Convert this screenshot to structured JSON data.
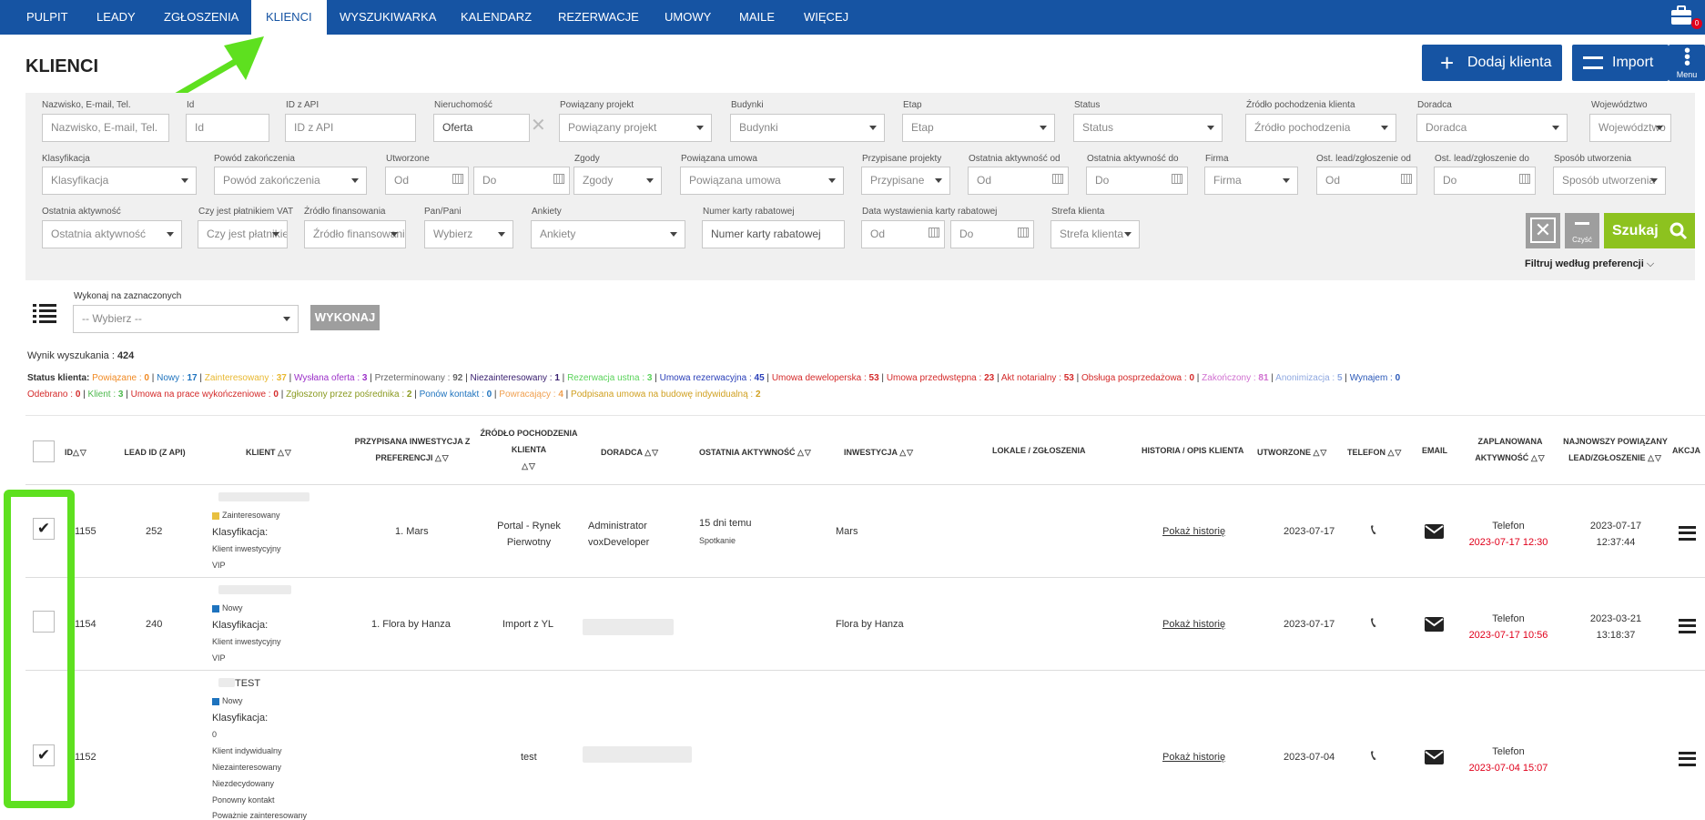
{
  "nav": {
    "items": [
      "PULPIT",
      "LEADY",
      "ZGŁOSZENIA",
      "KLIENCI",
      "WYSZUKIWARKA",
      "KALENDARZ",
      "REZERWACJE",
      "UMOWY",
      "MAILE",
      "WIĘCEJ"
    ],
    "active": "KLIENCI",
    "notif_count": "0"
  },
  "page": {
    "title": "KLIENCI",
    "add_label": "Dodaj klienta",
    "import_label": "Import",
    "menu_label": "Menu"
  },
  "filters": {
    "name": {
      "label": "Nazwisko, E-mail, Tel.",
      "placeholder": "Nazwisko, E-mail, Tel."
    },
    "id": {
      "label": "Id",
      "placeholder": "Id"
    },
    "api_id": {
      "label": "ID z API",
      "placeholder": "ID z API"
    },
    "property": {
      "label": "Nieruchomość",
      "value": "Oferta"
    },
    "project": {
      "label": "Powiązany projekt",
      "placeholder": "Powiązany projekt"
    },
    "buildings": {
      "label": "Budynki",
      "placeholder": "Budynki"
    },
    "stage": {
      "label": "Etap",
      "placeholder": "Etap"
    },
    "status": {
      "label": "Status",
      "placeholder": "Status"
    },
    "source": {
      "label": "Źródło pochodzenia klienta",
      "placeholder": "Źródło pochodzenia"
    },
    "advisor": {
      "label": "Doradca",
      "placeholder": "Doradca"
    },
    "voivodeship": {
      "label": "Województwo",
      "placeholder": "Województwo"
    },
    "classification": {
      "label": "Klasyfikacja",
      "placeholder": "Klasyfikacja"
    },
    "close_reason": {
      "label": "Powód zakończenia",
      "placeholder": "Powód zakończenia"
    },
    "created": {
      "label": "Utworzone",
      "from": "Od",
      "to": "Do"
    },
    "consents": {
      "label": "Zgody",
      "placeholder": "Zgody"
    },
    "contract": {
      "label": "Powiązana umowa",
      "placeholder": "Powiązana umowa"
    },
    "assigned_projects": {
      "label": "Przypisane projekty",
      "placeholder": "Przypisane"
    },
    "last_activity_from": {
      "label": "Ostatnia aktywność od",
      "placeholder": "Od"
    },
    "last_activity_to": {
      "label": "Ostatnia aktywność do",
      "placeholder": "Do"
    },
    "company": {
      "label": "Firma",
      "placeholder": "Firma"
    },
    "lead_from": {
      "label": "Ost. lead/zgłoszenie od",
      "placeholder": "Od"
    },
    "lead_to": {
      "label": "Ost. lead/zgłoszenie do",
      "placeholder": "Do"
    },
    "creation_method": {
      "label": "Sposób utworzenia",
      "placeholder": "Sposób utworzenia"
    },
    "last_activity": {
      "label": "Ostatnia aktywność",
      "placeholder": "Ostatnia aktywność"
    },
    "vat": {
      "label": "Czy jest płatnikiem VAT",
      "placeholder": "Czy jest płatnikiem"
    },
    "financing": {
      "label": "Źródło finansowania",
      "placeholder": "Źródło finansowania"
    },
    "salutation": {
      "label": "Pan/Pani",
      "placeholder": "Wybierz"
    },
    "surveys": {
      "label": "Ankiety",
      "placeholder": "Ankiety"
    },
    "card_number": {
      "label": "Numer karty rabatowej",
      "placeholder": "Numer karty rabatowej"
    },
    "card_date": {
      "label": "Data wystawienia karty rabatowej",
      "from": "Od",
      "to": "Do"
    },
    "zone": {
      "label": "Strefa klienta",
      "placeholder": "Strefa klienta"
    },
    "clear_label": "Czyść",
    "search_label": "Szukaj",
    "prefs_label": "Filtruj według preferencji"
  },
  "bulk": {
    "label": "Wykonaj na zaznaczonych",
    "placeholder": "-- Wybierz --",
    "execute": "WYKONAJ"
  },
  "results": {
    "label": "Wynik wyszukania :",
    "count": "424"
  },
  "status_legend": {
    "title": "Status klienta:",
    "line1": [
      {
        "name": "Powiązane",
        "count": "0",
        "color": "#f08a24"
      },
      {
        "name": "Nowy",
        "count": "17",
        "color": "#1e73be"
      },
      {
        "name": "Zainteresowany",
        "count": "37",
        "color": "#e8b830"
      },
      {
        "name": "Wysłana oferta",
        "count": "3",
        "color": "#9b30c8"
      },
      {
        "name": "Przeterminowany",
        "count": "92",
        "color": "#666666"
      },
      {
        "name": "Niezainteresowany",
        "count": "1",
        "color": "#3a2070"
      },
      {
        "name": "Rezerwacja ustna",
        "count": "3",
        "color": "#5ad35a"
      },
      {
        "name": "Umowa rezerwacyjna",
        "count": "45",
        "color": "#2a3fb8"
      },
      {
        "name": "Umowa deweloperska",
        "count": "53",
        "color": "#d42a2a"
      },
      {
        "name": "Umowa przedwstępna",
        "count": "23",
        "color": "#d42a2a"
      },
      {
        "name": "Akt notarialny",
        "count": "53",
        "color": "#d42a2a"
      },
      {
        "name": "Obsługa posprzedażowa",
        "count": "0",
        "color": "#d42a2a"
      },
      {
        "name": "Zakończony",
        "count": "81",
        "color": "#d070d0"
      },
      {
        "name": "Anonimizacja",
        "count": "5",
        "color": "#8fa8e0"
      },
      {
        "name": "Wynajem",
        "count": "0",
        "color": "#2a58b8"
      }
    ],
    "line2": [
      {
        "name": "Odebrano",
        "count": "0",
        "color": "#d42a2a"
      },
      {
        "name": "Klient",
        "count": "3",
        "color": "#4cb84c"
      },
      {
        "name": "Umowa na prace wykończeniowe",
        "count": "0",
        "color": "#d42a2a"
      },
      {
        "name": "Zgłoszony przez pośrednika",
        "count": "2",
        "color": "#8a9a20"
      },
      {
        "name": "Ponów kontakt",
        "count": "0",
        "color": "#1e73be"
      },
      {
        "name": "Powracający",
        "count": "4",
        "color": "#f0a050"
      },
      {
        "name": "Podpisana umowa na budowę indywidualną",
        "count": "2",
        "color": "#d0a020"
      }
    ]
  },
  "table": {
    "headers": {
      "id": "ID",
      "lead_id": "LEAD ID (Z API)",
      "client": "KLIENT",
      "investment_pref": "PRZYPISANA INWESTYCJA Z PREFERENCJI",
      "source": "ŹRÓDŁO POCHODZENIA KLIENTA",
      "advisor": "DORADCA",
      "last_activity": "OSTATNIA AKTYWNOŚĆ",
      "investment": "INWESTYCJA",
      "units": "LOKALE / ZGŁOSZENIA",
      "history": "HISTORIA / OPIS KLIENTA",
      "created": "UTWORZONE",
      "phone": "TELEFON",
      "email": "EMAIL",
      "planned": "ZAPLANOWANA AKTYWNOŚĆ",
      "newest_lead": "NAJNOWSZY POWIĄZANY LEAD/ZGŁOSZENIE",
      "action": "AKCJA"
    },
    "rows": [
      {
        "checked": true,
        "id": "1155",
        "lead_id": "252",
        "status": "Zainteresowany",
        "status_color": "#e8c040",
        "klasyfikacja_label": "Klasyfikacja:",
        "klasyfikacja": [
          "Klient inwestycyjny",
          "VIP"
        ],
        "investment_pref": "1. Mars",
        "source": [
          "Portal - Rynek",
          "Pierwotny"
        ],
        "advisor": [
          "Administrator",
          "voxDeveloper"
        ],
        "last_activity": "15 dni temu",
        "last_activity_type": "Spotkanie",
        "investment": "Mars",
        "history": "Pokaż historię",
        "created": "2023-07-17",
        "planned_type": "Telefon",
        "planned_date": "2023-07-17 12:30",
        "newest_date": "2023-07-17",
        "newest_time": "12:37:44"
      },
      {
        "checked": false,
        "id": "1154",
        "lead_id": "240",
        "status": "Nowy",
        "status_color": "#1e73be",
        "klasyfikacja_label": "Klasyfikacja:",
        "klasyfikacja": [
          "Klient inwestycyjny",
          "VIP"
        ],
        "investment_pref": "1. Flora by Hanza",
        "source": [
          "Import z YL"
        ],
        "advisor": [],
        "last_activity": "",
        "last_activity_type": "",
        "investment": "Flora by Hanza",
        "history": "Pokaż historię",
        "created": "2023-07-17",
        "planned_type": "Telefon",
        "planned_date": "2023-07-17 10:56",
        "newest_date": "2023-03-21",
        "newest_time": "13:18:37"
      },
      {
        "checked": true,
        "id": "1152",
        "lead_id": "",
        "name_suffix": "TEST",
        "status": "Nowy",
        "status_color": "#1e73be",
        "klasyfikacja_label": "Klasyfikacja:",
        "klasyfikacja": [
          "0",
          "Klient indywidualny",
          "Niezainteresowany",
          "Niezdecydowany",
          "Ponowny kontakt",
          "Poważnie zainteresowany"
        ],
        "investment_pref": "",
        "source": [
          "test"
        ],
        "advisor": [],
        "last_activity": "",
        "last_activity_type": "",
        "investment": "",
        "history": "Pokaż historię",
        "created": "2023-07-04",
        "planned_type": "Telefon",
        "planned_date": "2023-07-04 15:07",
        "newest_date": "",
        "newest_time": ""
      }
    ]
  },
  "colors": {
    "brand": "#1654a3",
    "search_green": "#8dc21f",
    "highlight_green": "#5ee01f",
    "danger": "#e0001b"
  }
}
